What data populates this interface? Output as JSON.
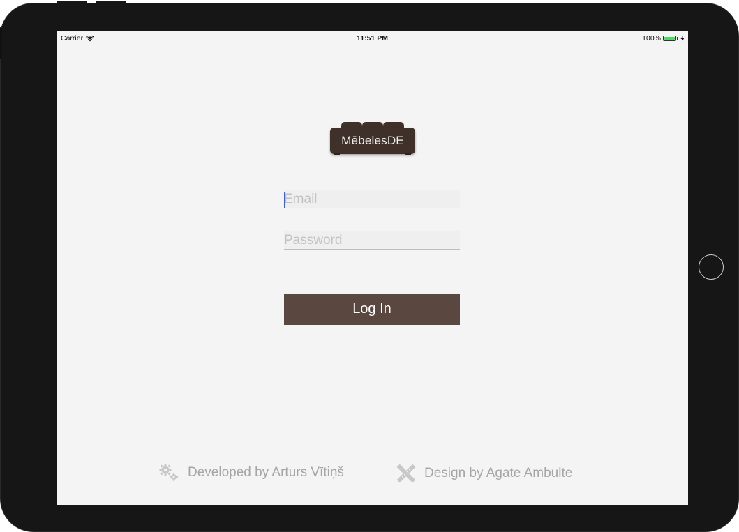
{
  "status_bar": {
    "carrier": "Carrier",
    "time": "11:51 PM",
    "battery": "100%",
    "wifi_icon": "wifi-icon",
    "battery_icon": "battery-icon",
    "charging_icon": "charging-bolt-icon"
  },
  "logo": {
    "text": "MēbelesDE",
    "icon": "sofa-logo",
    "color": "#3f3129"
  },
  "form": {
    "email_placeholder": "Email",
    "email_value": "",
    "password_placeholder": "Password",
    "password_value": "",
    "login_label": "Log In",
    "button_color": "#5a4840"
  },
  "footer": {
    "developer_text": "Developed by Arturs Vītiņš",
    "developer_icon": "gears-icon",
    "design_text": "Design by Agate Ambulte",
    "design_icon": "pencil-ruler-icon"
  }
}
